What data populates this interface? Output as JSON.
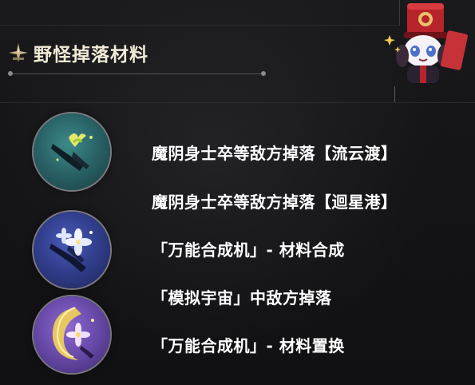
{
  "header": {
    "title": "野怪掉落材料",
    "icon": "star-compass-icon"
  },
  "materials": [
    {
      "icon": "teal-bud-material-icon",
      "tier_color": "#2a6468"
    },
    {
      "icon": "blue-flower-material-icon",
      "tier_color": "#323f8e"
    },
    {
      "icon": "purple-gold-crescent-material-icon",
      "tier_color": "#6a4bab"
    }
  ],
  "sources": [
    "魔阴身士卒等敌方掉落【流云渡】",
    "魔阴身士卒等敌方掉落【迴星港】",
    "「万能合成机」- 材料合成",
    "「模拟宇宙」中敌方掉落",
    "「万能合成机」- 材料置换"
  ],
  "mascot": {
    "icon": "pom-pom-mascot-icon"
  },
  "colors": {
    "title": "#f2ead8",
    "text": "#ffffff",
    "background": "#141416"
  }
}
